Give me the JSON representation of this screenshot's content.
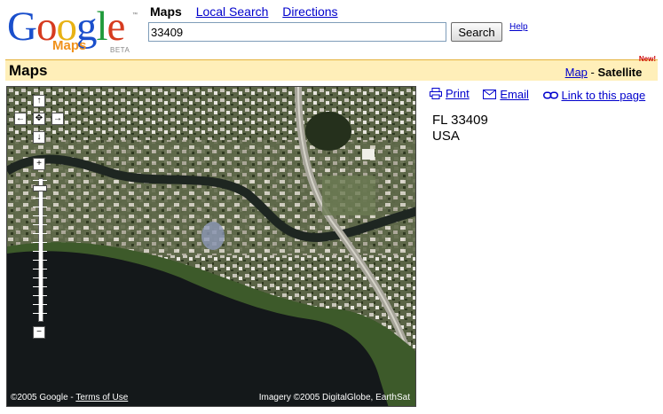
{
  "logo": {
    "letters": [
      "G",
      "o",
      "o",
      "g",
      "l",
      "e"
    ],
    "trademark": "™",
    "product": "Maps",
    "badge": "BETA"
  },
  "nav": {
    "current": "Maps",
    "links": [
      "Local Search",
      "Directions"
    ]
  },
  "search": {
    "value": "33409",
    "button_label": "Search",
    "help_label": "Help"
  },
  "titlebar": {
    "title": "Maps",
    "map_link": "Map",
    "separator": "-",
    "satellite_label": "Satellite",
    "new_badge": "New!"
  },
  "map": {
    "pan_up": "↑",
    "pan_left": "←",
    "pan_center": "✥",
    "pan_right": "→",
    "pan_down": "↓",
    "zoom_in": "+",
    "zoom_out": "−",
    "copyright": "©2005 Google - ",
    "terms_label": "Terms of Use",
    "imagery": "Imagery ©2005 DigitalGlobe, EarthSat"
  },
  "side": {
    "print_label": "Print",
    "email_label": "Email",
    "link_label": "Link to this page",
    "address_line1": "FL 33409",
    "address_line2": "USA"
  },
  "colors": {
    "link": "#0000cc",
    "titlebar_bg": "#ffefb9",
    "titlebar_border": "#e4b23a",
    "new_badge": "#cc0000",
    "lake": "#14181a",
    "land": "#4f5a3c"
  },
  "icons": [
    "up-arrow-icon",
    "left-arrow-icon",
    "center-icon",
    "right-arrow-icon",
    "down-arrow-icon",
    "zoom-in-icon",
    "zoom-out-icon",
    "printer-icon",
    "envelope-icon",
    "chain-link-icon"
  ]
}
